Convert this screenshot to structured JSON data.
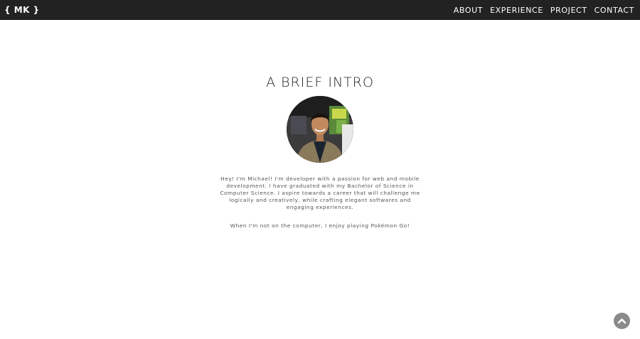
{
  "navbar": {
    "brand": "{ MK }",
    "links": [
      {
        "label": "ABOUT"
      },
      {
        "label": "EXPERIENCE"
      },
      {
        "label": "PROJECT"
      },
      {
        "label": "CONTACT"
      }
    ]
  },
  "intro": {
    "title": "A BRIEF INTRO",
    "bio": "Hey! I'm Michael! I'm developer with a passion for web and mobile development. I have graduated with my Bachelor of Science in Computer Science. I aspire towards a career that will challenge me logically and creatively, while crafting elegant softwares and engaging experiences.",
    "hobby": "When I'm not on the computer, I enjoy playing Pokémon Go!"
  },
  "scroll_top": {
    "icon": "chevron-up-icon"
  },
  "colors": {
    "navbar_bg": "#222222",
    "nav_text": "#ffffff",
    "scroll_button": "#8a8a8a"
  }
}
